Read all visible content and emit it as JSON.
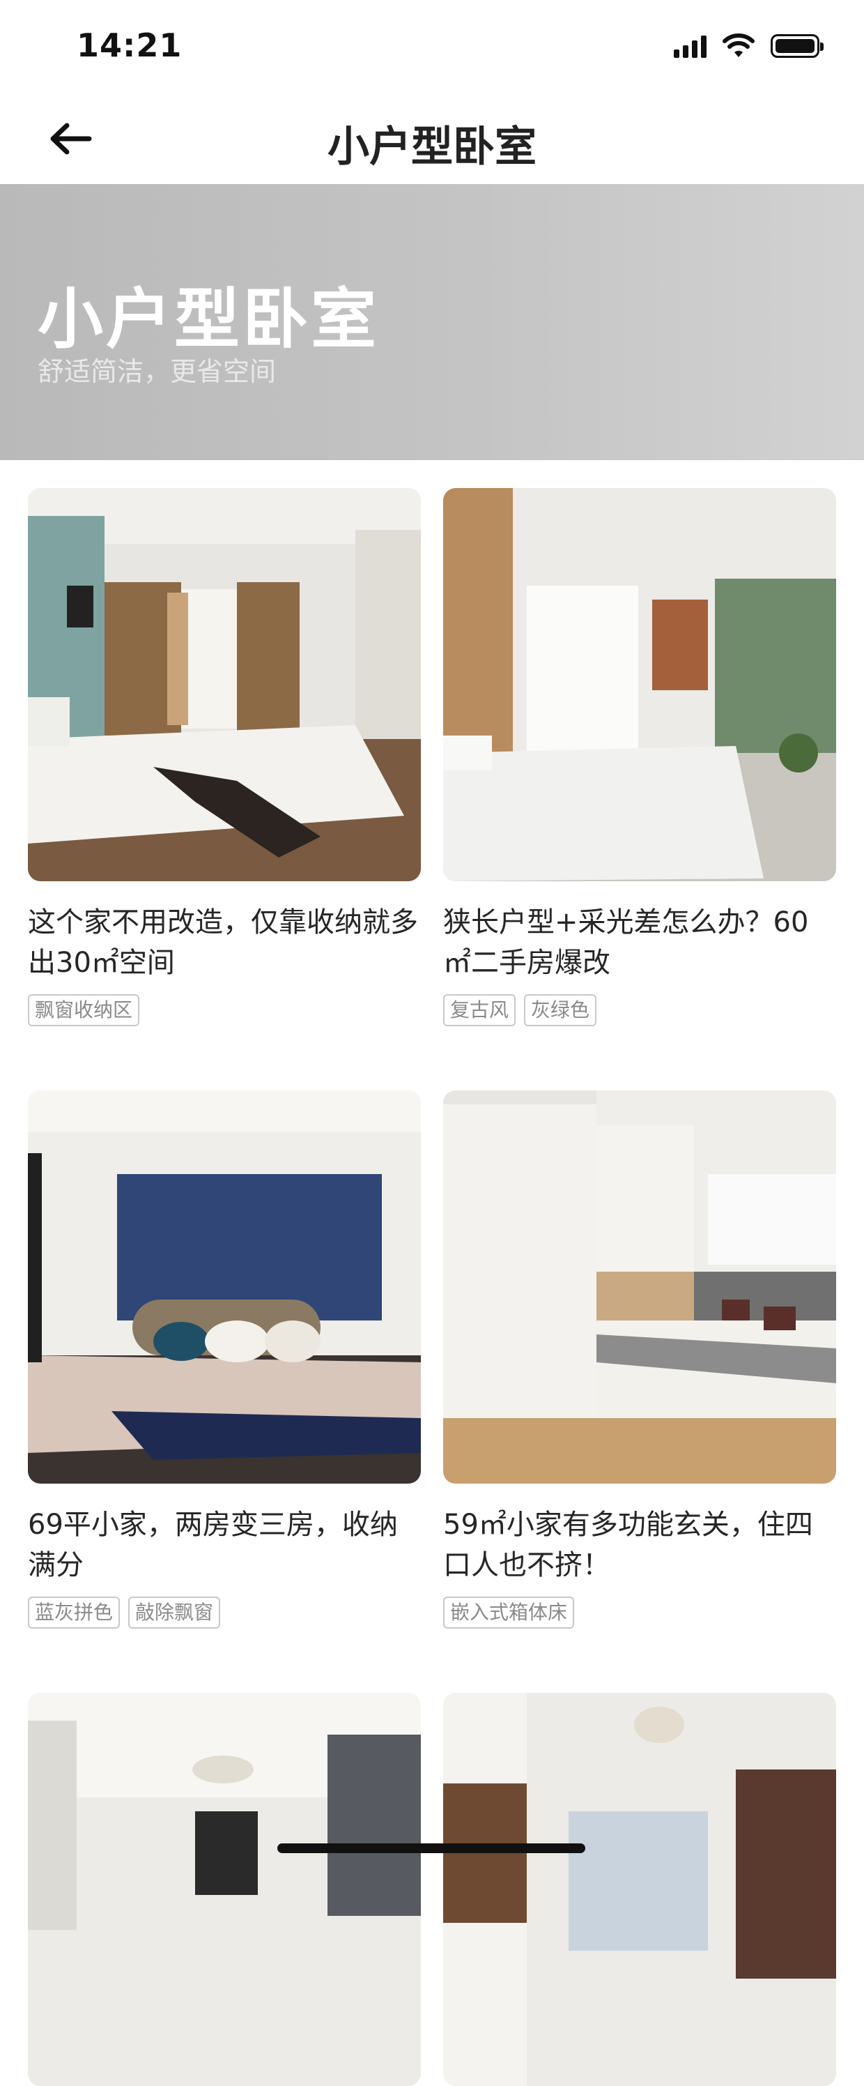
{
  "status_bar": {
    "time": "14:21"
  },
  "nav": {
    "title": "小户型卧室"
  },
  "banner": {
    "title": "小户型卧室",
    "subtitle": "舒适简洁，更省空间"
  },
  "cards": [
    {
      "title": "这个家不用改造，仅靠收纳就多出30㎡空间",
      "tags": [
        "飘窗收纳区"
      ]
    },
    {
      "title": "狭长户型+采光差怎么办？60㎡二手房爆改",
      "tags": [
        "复古风",
        "灰绿色"
      ]
    },
    {
      "title": "69平小家，两房变三房，收纳满分",
      "tags": [
        "蓝灰拼色",
        "敲除飘窗"
      ]
    },
    {
      "title": "59㎡小家有多功能玄关，住四口人也不挤！",
      "tags": [
        "嵌入式箱体床"
      ]
    }
  ],
  "icons": {
    "back": "arrow-left-icon",
    "signal": "cellular-signal-icon",
    "wifi": "wifi-icon",
    "battery": "battery-icon"
  }
}
